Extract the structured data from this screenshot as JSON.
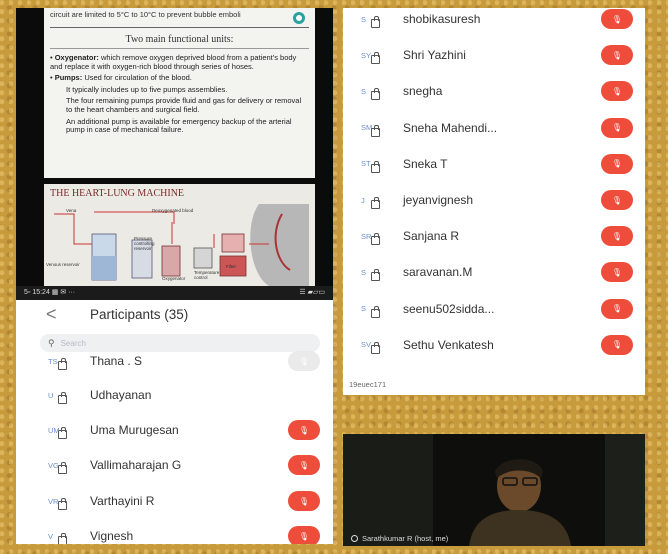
{
  "slide": {
    "caption": "circuit are limited to 5°C to 10°C to prevent bubble emboli",
    "heading": "Two main functional units:",
    "oxygenator_term": "Oxygenator:",
    "oxygenator_text": "which remove oxygen deprived blood from a patient's body and replace it with oxygen-rich blood through series of hoses.",
    "pumps_term": "Pumps:",
    "pumps_text": "Used for circulation of the blood.",
    "pumps_line2": "It typically includes up to five pumps assemblies.",
    "pumps_line3": "The four remaining pumps provide fluid and gas for delivery or removal to the heart chambers and surgical field.",
    "pumps_line4": "An additional pump is available for emergency backup of the arterial pump in case of mechanical failure.",
    "diagram_title": "THE HEART-LUNG MACHINE",
    "diagram_labels": [
      "Vena",
      "Deoxygenated blood",
      "Venous reservoir",
      "Pressure controlling reservoir",
      "Oxygenator",
      "Temperature control",
      "Filter"
    ]
  },
  "statusbar": {
    "left": "5▫ 15:24 ▦ ✉ ···",
    "right": "☰ ▰▱▭"
  },
  "participants_header": {
    "back_glyph": "<",
    "title": "Participants (35)",
    "search_placeholder": "Search"
  },
  "left_participants": [
    {
      "initials": "TS",
      "name": "Thana . S",
      "mic": "gray"
    },
    {
      "initials": "U",
      "name": "Udhayanan",
      "mic": "none"
    },
    {
      "initials": "UM",
      "name": "Uma Murugesan",
      "mic": "red"
    },
    {
      "initials": "VG",
      "name": "Vallimaharajan G",
      "mic": "red"
    },
    {
      "initials": "VR",
      "name": "Varthayini R",
      "mic": "red"
    },
    {
      "initials": "V",
      "name": "Vignesh",
      "mic": "red"
    }
  ],
  "right_participants": [
    {
      "initials": "S",
      "name": "shobikasuresh"
    },
    {
      "initials": "SY",
      "name": "Shri Yazhini"
    },
    {
      "initials": "S",
      "name": "snegha"
    },
    {
      "initials": "SM",
      "name": "Sneha Mahendi..."
    },
    {
      "initials": "ST",
      "name": "Sneka T"
    },
    {
      "initials": "J",
      "name": "jeyanvignesh"
    },
    {
      "initials": "SR",
      "name": "Sanjana R"
    },
    {
      "initials": "S",
      "name": "saravanan.M"
    },
    {
      "initials": "S",
      "name": "seenu502sidda..."
    },
    {
      "initials": "SV",
      "name": "Sethu Venkatesh"
    }
  ],
  "right_footer": "19euec171",
  "video": {
    "label": "Sarathkumar R (host, me)"
  },
  "colors": {
    "mic_red": "#ee4d3b",
    "avatar_text": "#6b8ec9",
    "frame": "#c79a3c"
  },
  "icons": {
    "mic": "mic-icon",
    "search": "search-icon",
    "back": "back-chevron-icon",
    "video_off": "video-off-icon"
  }
}
